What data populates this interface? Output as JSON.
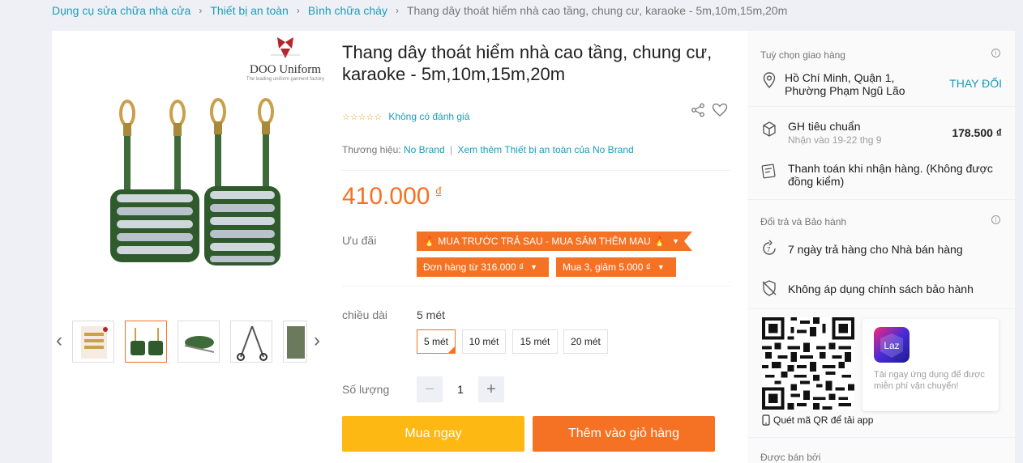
{
  "breadcrumb": {
    "items": [
      "Dụng cụ sửa chữa nhà cửa",
      "Thiết bị an toàn",
      "Bình chữa cháy"
    ],
    "current": "Thang dây thoát hiểm nhà cao tầng, chung cư, karaoke - 5m,10m,15m,20m"
  },
  "gallery": {
    "logo_name": "DOO Uniform",
    "logo_tagline": "The leading uniform garment factory",
    "thumbnails": [
      "thumb-1",
      "thumb-2",
      "thumb-3",
      "thumb-4",
      "thumb-5"
    ],
    "active_thumbnail": 2
  },
  "product": {
    "title": "Thang dây thoát hiểm nhà cao tầng, chung cư, karaoke - 5m,10m,15m,20m",
    "rating_text": "Không có đánh giá",
    "brand_label": "Thương hiệu:",
    "brand_name": "No Brand",
    "brand_more": "Xem thêm Thiết bị an toàn của No Brand",
    "price": "410.000",
    "currency": "₫"
  },
  "promotions": {
    "label": "Ưu đãi",
    "banner": "🔥 MUA TRƯỚC TRẢ SAU - MUA SẮM THÊM MAU 🔥",
    "voucher_1": "Đơn hàng từ 316.000 ₫",
    "voucher_2": "Mua 3, giảm 5.000 ₫"
  },
  "variant": {
    "label": "chiều dài",
    "selected": "5 mét",
    "options": [
      "5 mét",
      "10 mét",
      "15 mét",
      "20 mét"
    ]
  },
  "quantity": {
    "label": "Số lượng",
    "value": "1",
    "minus": "−",
    "plus": "+"
  },
  "actions": {
    "buy_now": "Mua ngay",
    "add_to_cart": "Thêm vào giỏ hàng"
  },
  "delivery": {
    "title": "Tuỳ chọn giao hàng",
    "address": "Hồ Chí Minh, Quận 1, Phường Phạm Ngũ Lão",
    "change": "THAY ĐỔI",
    "shipping_name": "GH tiêu chuẩn",
    "shipping_eta": "Nhận vào 19-22 thg 9",
    "shipping_fee": "178.500 ₫",
    "cod": "Thanh toán khi nhận hàng. (Không được đồng kiểm)"
  },
  "returns": {
    "title": "Đổi trả và Bảo hành",
    "return_policy": "7 ngày trả hàng cho Nhà bán hàng",
    "warranty": "Không áp dụng chính sách bảo hành"
  },
  "app_promo": {
    "logo_text": "Laz",
    "text": "Tải ngay ứng dụng để được miễn phí vận chuyển!",
    "qr_caption": "Quét mã QR để tải app"
  },
  "seller": {
    "title": "Được bán bởi"
  },
  "colors": {
    "accent": "#f57224",
    "link": "#1a9cb7",
    "buy": "#fdb813"
  }
}
